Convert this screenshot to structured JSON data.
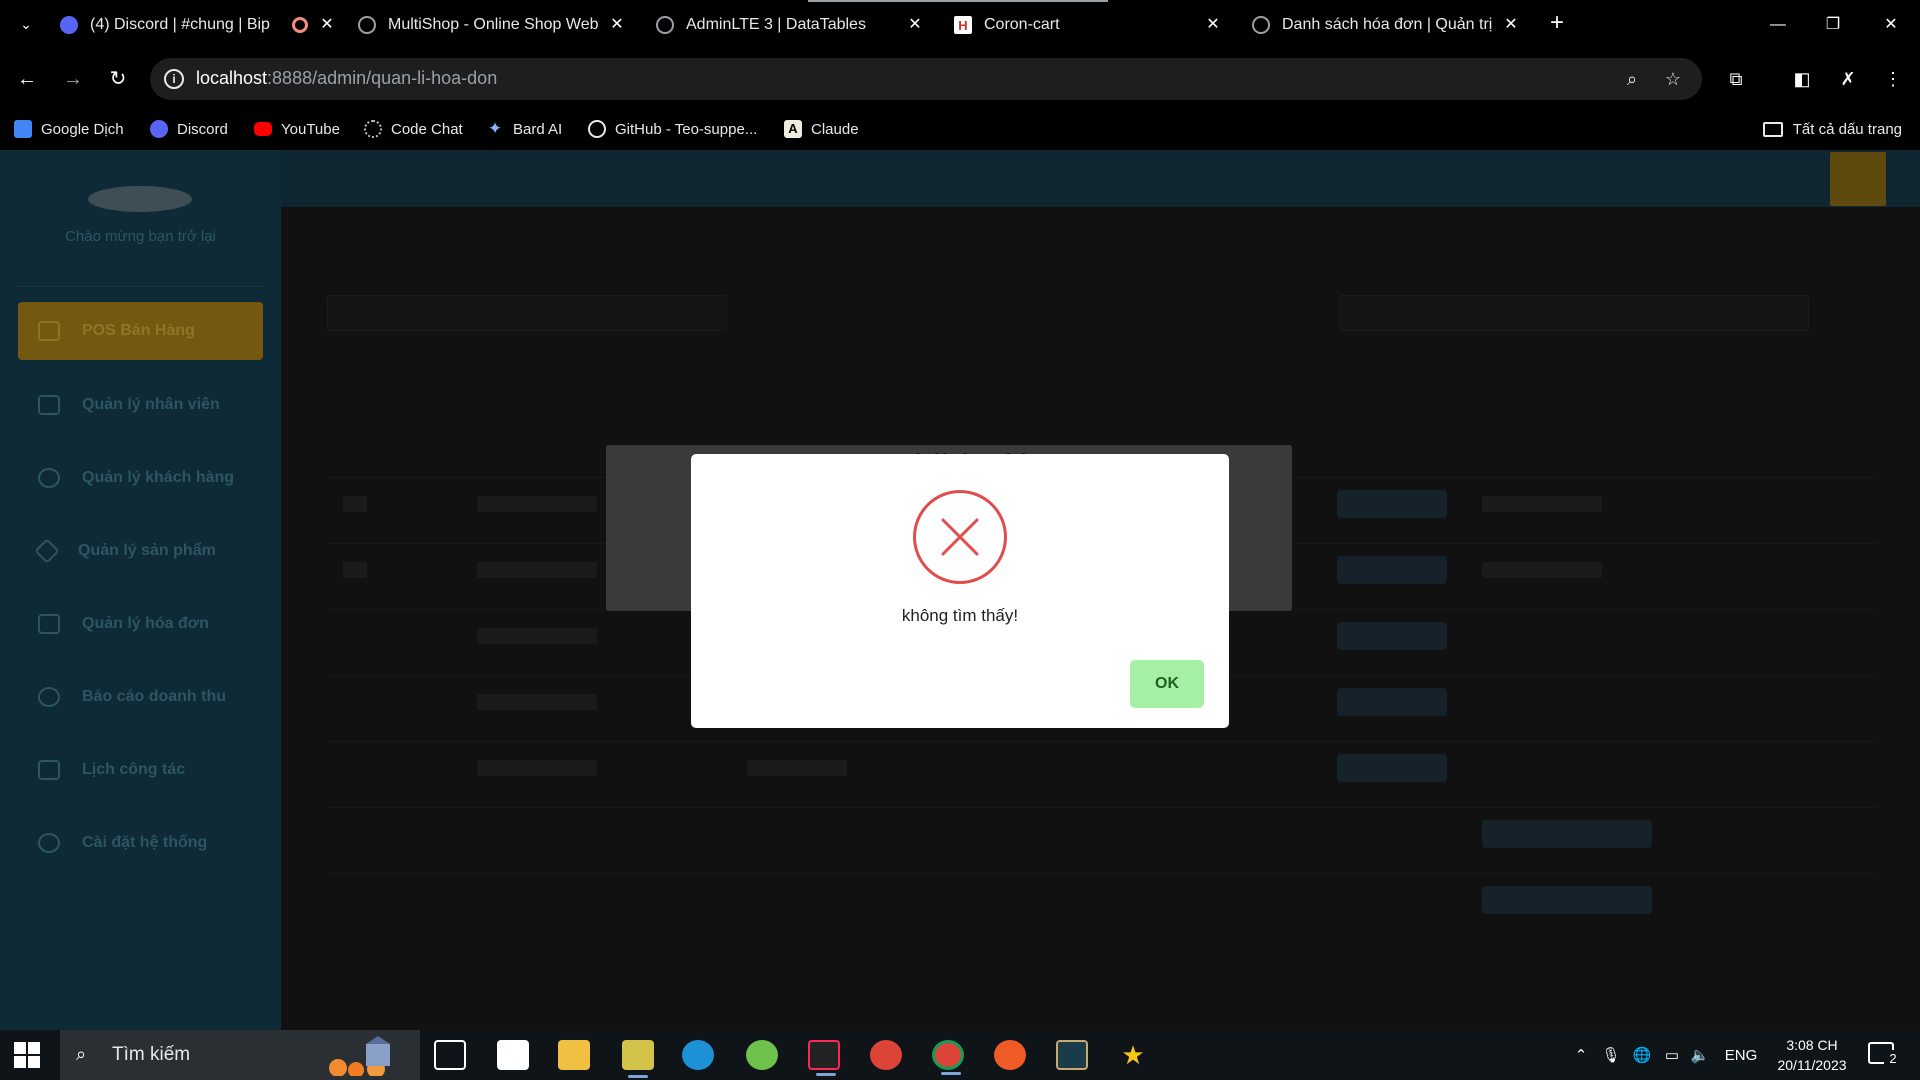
{
  "browser": {
    "tabs": [
      {
        "title": "(4) Discord | #chung | Bip",
        "favicon": "discord-icon",
        "color": "#5865f2"
      },
      {
        "title": "MultiShop - Online Shop Websi",
        "favicon": "globe-icon",
        "color": "#9aa0a6"
      },
      {
        "title": "AdminLTE 3 | DataTables",
        "favicon": "globe-icon",
        "color": "#9aa0a6"
      },
      {
        "title": "Coron-cart",
        "favicon": "coron-cart-icon",
        "color": "#d93025"
      },
      {
        "title": "Danh sách hóa đơn | Quản trị A",
        "favicon": "globe-icon",
        "color": "#9aa0a6"
      }
    ],
    "url_host": "localhost",
    "url_path": ":8888/admin/quan-li-hoa-don",
    "bookmarks": [
      {
        "label": "Google Dịch",
        "icon": "google-translate-icon",
        "color": "#4285f4"
      },
      {
        "label": "Discord",
        "icon": "discord-icon",
        "color": "#5865f2"
      },
      {
        "label": "YouTube",
        "icon": "youtube-icon",
        "color": "#ff0000"
      },
      {
        "label": "Code Chat",
        "icon": "code-chat-icon",
        "color": "#bdbdbd"
      },
      {
        "label": "Bard AI",
        "icon": "bard-icon",
        "color": "#8ab4f8"
      },
      {
        "label": "GitHub - Teo-suppe...",
        "icon": "github-icon",
        "color": "#e8e8e8"
      },
      {
        "label": "Claude",
        "icon": "claude-icon",
        "color": "#d97757"
      }
    ],
    "all_bookmarks": "Tất cả dấu trang"
  },
  "admin": {
    "welcome": "Chào mừng bạn trở lại",
    "menu": [
      {
        "label": "POS Bán Hàng",
        "icon": "cart-icon"
      },
      {
        "label": "Quản lý nhân viên",
        "icon": "id-card-icon"
      },
      {
        "label": "Quản lý khách hàng",
        "icon": "user-voice-icon"
      },
      {
        "label": "Quản lý sản phẩm",
        "icon": "tag-icon"
      },
      {
        "label": "Quản lý hóa đơn",
        "icon": "clipboard-check-icon"
      },
      {
        "label": "Báo cáo doanh thu",
        "icon": "pie-chart-icon"
      },
      {
        "label": "Lịch công tác",
        "icon": "calendar-check-icon"
      },
      {
        "label": "Cài đặt hệ thống",
        "icon": "gear-icon"
      }
    ]
  },
  "background_modal": {
    "title": "Trạng thái đơn hàng"
  },
  "alert": {
    "message": "không tìm thấy!",
    "ok_label": "OK",
    "icon": "error-x-icon",
    "accent": "#e24b4b",
    "button_color": "#a5f0a5"
  },
  "taskbar": {
    "search_placeholder": "Tìm kiếm",
    "apps": [
      "task-view-icon",
      "store-icon",
      "file-explorer-icon",
      "sticky-icon",
      "edge-icon",
      "app-green-icon",
      "intellij-icon",
      "chrome-icon",
      "chrome-profile-icon",
      "postman-icon",
      "league-icon",
      "star-app-icon"
    ],
    "language": "ENG",
    "time": "3:08 CH",
    "date": "20/11/2023",
    "notifications": "2"
  }
}
